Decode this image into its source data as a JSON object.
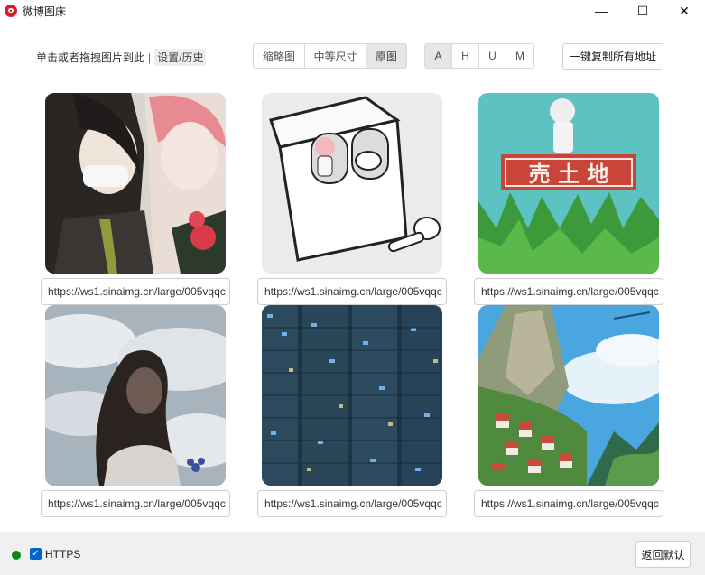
{
  "window": {
    "title": "微博图床",
    "controls": {
      "minimize": "—",
      "maximize": "☐",
      "close": "✕"
    }
  },
  "toolbar": {
    "hint_text": "单击或者拖拽图片到此",
    "hint_separator": "|",
    "settings_link": "设置/历史",
    "size_options": [
      "缩略图",
      "中等尺寸",
      "原图"
    ],
    "size_selected": "原图",
    "format_options": [
      "A",
      "H",
      "U",
      "M"
    ],
    "format_selected": "A",
    "copy_all_label": "一键复制所有地址"
  },
  "images": [
    {
      "url": "https://ws1.sinaimg.cn/large/005vqqc",
      "icon": "anime-girls-image"
    },
    {
      "url": "https://ws1.sinaimg.cn/large/005vqqc",
      "icon": "earbuds-case-image"
    },
    {
      "url": "https://ws1.sinaimg.cn/large/005vqqc",
      "icon": "sign-girl-image",
      "sign_text": "売 土 地"
    },
    {
      "url": "https://ws1.sinaimg.cn/large/005vqqc",
      "icon": "silhouette-clouds-image"
    },
    {
      "url": "https://ws1.sinaimg.cn/large/005vqqc",
      "icon": "city-tower-image"
    },
    {
      "url": "https://ws1.sinaimg.cn/large/005vqqc",
      "icon": "hillside-village-image"
    }
  ],
  "footer": {
    "https_label": "HTTPS",
    "https_checked": true,
    "status_color": "#0a8a0a",
    "reset_label": "返回默认"
  },
  "colors": {
    "accent": "#0066cc",
    "brand": "#e6162d"
  }
}
